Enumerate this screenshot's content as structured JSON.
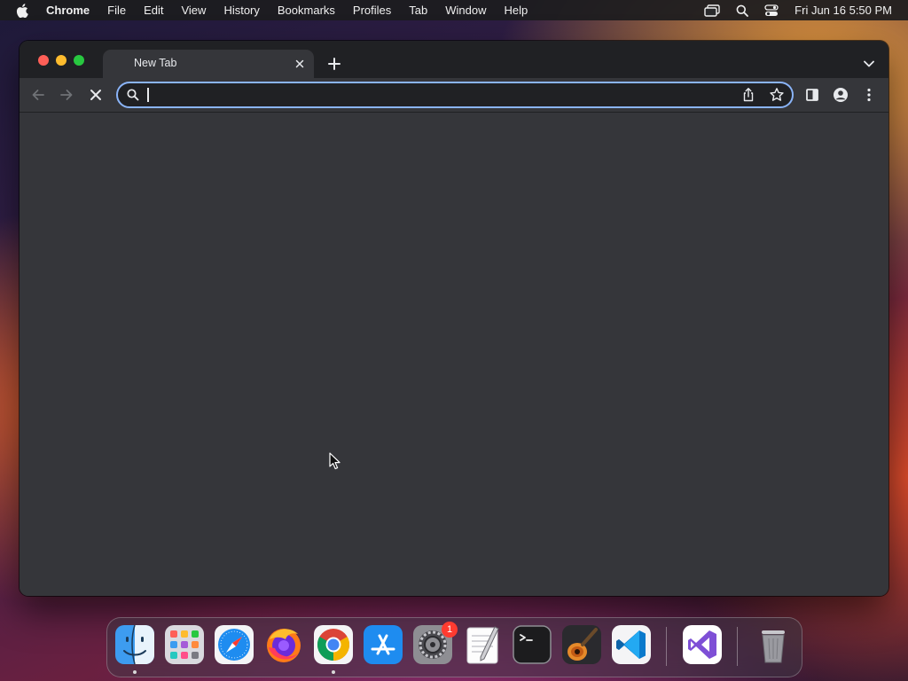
{
  "menubar": {
    "app_name": "Chrome",
    "items": [
      "File",
      "Edit",
      "View",
      "History",
      "Bookmarks",
      "Profiles",
      "Tab",
      "Window",
      "Help"
    ],
    "clock": "Fri Jun 16  5:50 PM"
  },
  "browser": {
    "tab_title": "New Tab",
    "omnibox_value": "",
    "accent_color": "#8ab4f8"
  },
  "dock": {
    "apps": [
      {
        "name": "Finder",
        "icon": "finder-icon",
        "running": true
      },
      {
        "name": "Launchpad",
        "icon": "launchpad-icon",
        "running": false
      },
      {
        "name": "Safari",
        "icon": "safari-icon",
        "running": false
      },
      {
        "name": "Firefox",
        "icon": "firefox-icon",
        "running": false
      },
      {
        "name": "Google Chrome",
        "icon": "chrome-icon",
        "running": true
      },
      {
        "name": "App Store",
        "icon": "app-store-icon",
        "running": false
      },
      {
        "name": "System Settings",
        "icon": "system-settings-icon",
        "running": false,
        "badge": "1"
      },
      {
        "name": "TextEdit",
        "icon": "textedit-icon",
        "running": false
      },
      {
        "name": "Terminal",
        "icon": "terminal-icon",
        "running": false
      },
      {
        "name": "GarageBand",
        "icon": "garageband-icon",
        "running": false
      },
      {
        "name": "Visual Studio Code",
        "icon": "vscode-icon",
        "running": false
      },
      {
        "name": "Visual Studio",
        "icon": "visual-studio-icon",
        "running": false
      },
      {
        "name": "Trash",
        "icon": "trash-icon",
        "running": false
      }
    ]
  }
}
